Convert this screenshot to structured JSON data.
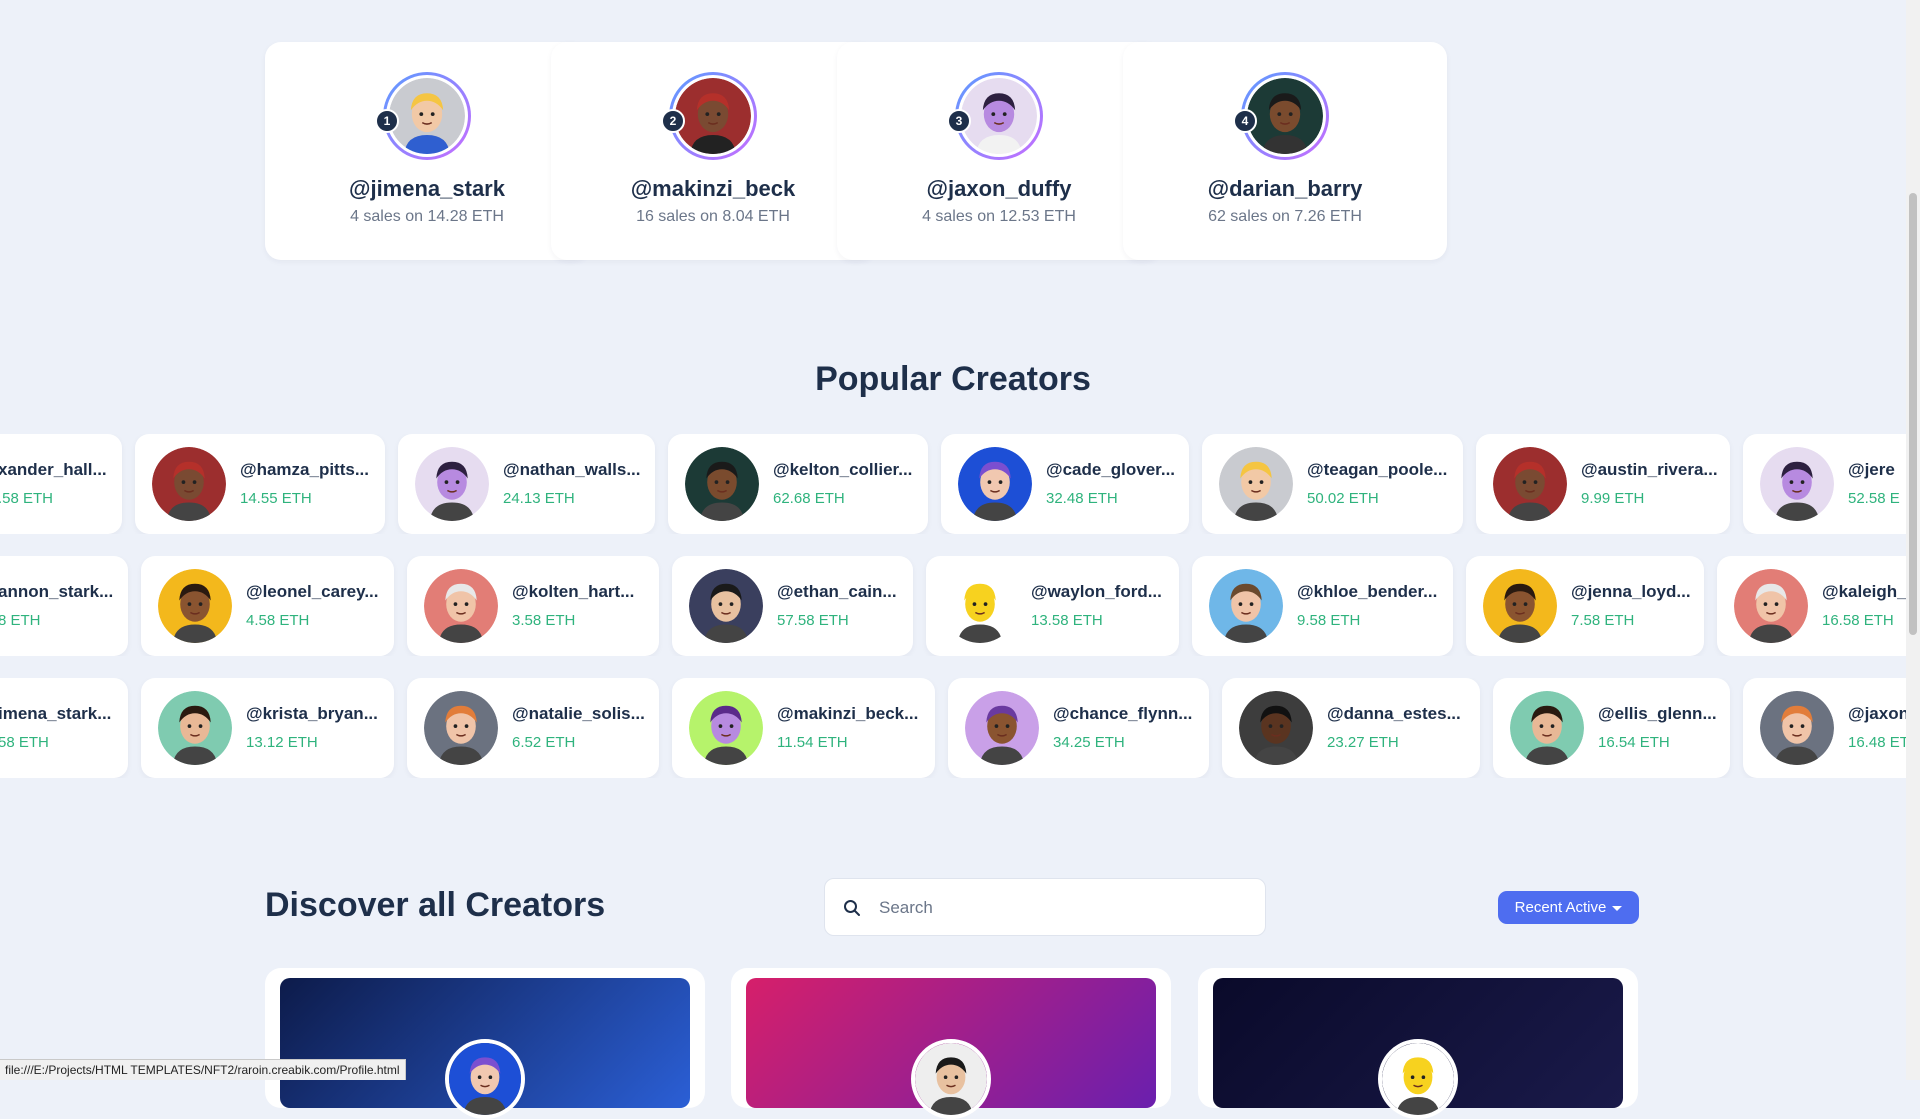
{
  "top_sellers": [
    {
      "rank": "1",
      "name": "@jimena_stark",
      "stats": "4 sales on 14.28 ETH",
      "avatar": "blond-boy",
      "skin": "#f2c9a6",
      "hair": "#f5c542",
      "bg": "#c9cbd0",
      "shirt": "#2f5fd0"
    },
    {
      "rank": "2",
      "name": "@makinzi_beck",
      "stats": "16 sales on 8.04 ETH",
      "avatar": "bearded-cap-man",
      "skin": "#7a4a32",
      "hair": "#b5302a",
      "bg": "#9c2e2e",
      "shirt": "#222"
    },
    {
      "rank": "3",
      "name": "@jaxon_duffy",
      "stats": "4 sales on 12.53 ETH",
      "avatar": "purple-man",
      "skin": "#b78ae0",
      "hair": "#2d2040",
      "bg": "#e6dcf0",
      "shirt": "#f2f2f2"
    },
    {
      "rank": "4",
      "name": "@darian_barry",
      "stats": "62 sales on 7.26 ETH",
      "avatar": "dark-man",
      "skin": "#7a4b2e",
      "hair": "#1a1a1a",
      "bg": "#1c3a36",
      "shirt": "#333"
    }
  ],
  "popular": {
    "title": "Popular Creators",
    "rows": [
      [
        {
          "name": "xander_hall...",
          "eth": ".58 ETH",
          "skin": "#f2c9a6",
          "hair": "#f5c542",
          "bg": "#c9cbd0"
        },
        {
          "name": "@hamza_pitts...",
          "eth": "14.55 ETH",
          "skin": "#7a4a32",
          "hair": "#b5302a",
          "bg": "#9c2e2e"
        },
        {
          "name": "@nathan_walls...",
          "eth": "24.13 ETH",
          "skin": "#b78ae0",
          "hair": "#2d2040",
          "bg": "#e6dcf0"
        },
        {
          "name": "@kelton_collier...",
          "eth": "62.68 ETH",
          "skin": "#7a4b2e",
          "hair": "#1a1a1a",
          "bg": "#1c3a36"
        },
        {
          "name": "@cade_glover...",
          "eth": "32.48 ETH",
          "skin": "#f1c8b0",
          "hair": "#7b4fd0",
          "bg": "#1d4fd6"
        },
        {
          "name": "@teagan_poole...",
          "eth": "50.02 ETH",
          "skin": "#f2c9a6",
          "hair": "#f5c542",
          "bg": "#c9cbd0"
        },
        {
          "name": "@austin_rivera...",
          "eth": "9.99 ETH",
          "skin": "#7a4a32",
          "hair": "#b5302a",
          "bg": "#9c2e2e"
        },
        {
          "name": "@jere",
          "eth": "52.58 E",
          "skin": "#b78ae0",
          "hair": "#2d2040",
          "bg": "#e6dcf0"
        }
      ],
      [
        {
          "name": "annon_stark...",
          "eth": "8 ETH",
          "skin": "#f2c9a6",
          "hair": "#f5c542",
          "bg": "#c9cbd0"
        },
        {
          "name": "@leonel_carey...",
          "eth": "4.58 ETH",
          "skin": "#8a5430",
          "hair": "#2a1a10",
          "bg": "#f3b81c"
        },
        {
          "name": "@kolten_hart...",
          "eth": "3.58 ETH",
          "skin": "#f0c4a8",
          "hair": "#e8e8e8",
          "bg": "#e27d76"
        },
        {
          "name": "@ethan_cain...",
          "eth": "57.58 ETH",
          "skin": "#e8c1a0",
          "hair": "#1a1a1a",
          "bg": "#3a3f5e"
        },
        {
          "name": "@waylon_ford...",
          "eth": "13.58 ETH",
          "skin": "#f7d21f",
          "hair": "#f7d21f",
          "bg": "#ffffff"
        },
        {
          "name": "@khloe_bender...",
          "eth": "9.58 ETH",
          "skin": "#f0c4a8",
          "hair": "#6b4a2e",
          "bg": "#6fb7e8"
        },
        {
          "name": "@jenna_loyd...",
          "eth": "7.58 ETH",
          "skin": "#8a5430",
          "hair": "#2a1a10",
          "bg": "#f3b81c"
        },
        {
          "name": "@kaleigh_l",
          "eth": "16.58 ETH",
          "skin": "#f0c4a8",
          "hair": "#e8e8e8",
          "bg": "#e27d76"
        }
      ],
      [
        {
          "name": "imena_stark...",
          "eth": "58 ETH",
          "skin": "#f2c9a6",
          "hair": "#f5c542",
          "bg": "#c9cbd0"
        },
        {
          "name": "@krista_bryan...",
          "eth": "13.12 ETH",
          "skin": "#e8b896",
          "hair": "#2a1a10",
          "bg": "#7fcbb0"
        },
        {
          "name": "@natalie_solis...",
          "eth": "6.52 ETH",
          "skin": "#f0c4a8",
          "hair": "#e27d3a",
          "bg": "#6b7280"
        },
        {
          "name": "@makinzi_beck...",
          "eth": "11.54 ETH",
          "skin": "#b78ae0",
          "hair": "#5a2a8a",
          "bg": "#b6f36b"
        },
        {
          "name": "@chance_flynn...",
          "eth": "34.25 ETH",
          "skin": "#8a5430",
          "hair": "#6a3aa0",
          "bg": "#c9a0e8"
        },
        {
          "name": "@danna_estes...",
          "eth": "23.27 ETH",
          "skin": "#5a3420",
          "hair": "#111111",
          "bg": "#3d3d3d"
        },
        {
          "name": "@ellis_glenn...",
          "eth": "16.54 ETH",
          "skin": "#e8b896",
          "hair": "#2a1a10",
          "bg": "#7fcbb0"
        },
        {
          "name": "@jaxon",
          "eth": "16.48 ETH",
          "skin": "#f0c4a8",
          "hair": "#e27d3a",
          "bg": "#6b7280"
        }
      ]
    ]
  },
  "discover": {
    "title": "Discover all Creators",
    "search_placeholder": "Search",
    "sort_label": "Recent Active",
    "cards": [
      {
        "cover_from": "#0d1b4a",
        "cover_to": "#2b5fd6",
        "avatar_bg": "#1d4fd6",
        "skin": "#f1c8b0",
        "hair": "#7b4fd0"
      },
      {
        "cover_from": "#d61f6a",
        "cover_to": "#6a1fae",
        "avatar_bg": "#eeeeee",
        "skin": "#e8c1a0",
        "hair": "#1a1a1a"
      },
      {
        "cover_from": "#0a0a2a",
        "cover_to": "#1a1a4a",
        "avatar_bg": "#ffffff",
        "skin": "#f7d21f",
        "hair": "#f7d21f"
      }
    ]
  },
  "status_bar": "file:///E:/Projects/HTML TEMPLATES/NFT2/raroin.creabik.com/Profile.html"
}
